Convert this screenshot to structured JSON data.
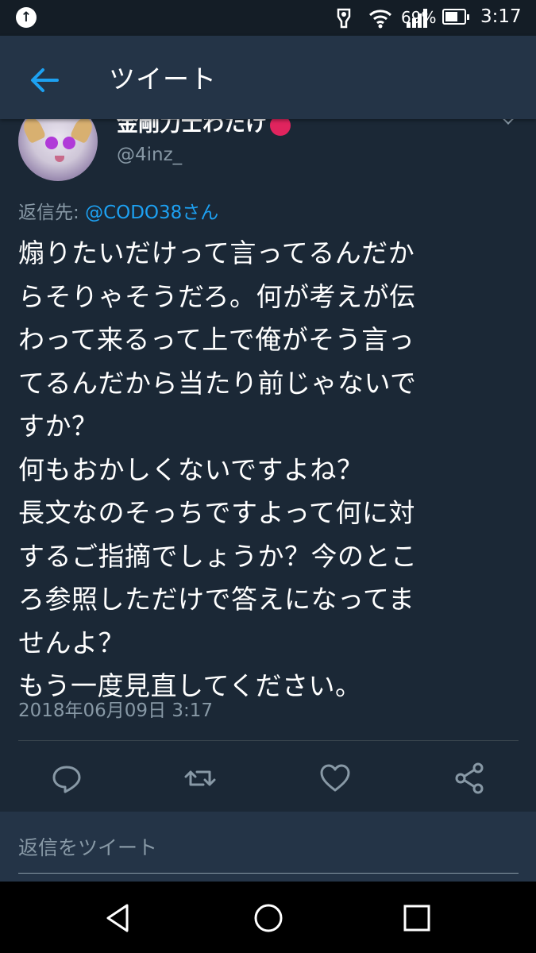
{
  "status_bar": {
    "battery_percent": "69%",
    "time": "3:17",
    "battery_level": 0.69
  },
  "app_bar": {
    "title": "ツイート"
  },
  "tweet": {
    "display_name": "金剛力士わたけ",
    "handle": "@4inz_",
    "replying_to_prefix": "返信先: ",
    "replying_to_mention": "@CODO38さん",
    "text_lines": [
      "煽りたいだけって言ってるんだか",
      "らそりゃそうだろ。何が考えが伝",
      "わって来るって上で俺がそう言っ",
      "てるんだから当たり前じゃないで",
      "すか？",
      "何もおかしくないですよね？",
      "長文なのそっちですよって何に対",
      "するご指摘でしょうか？今のとこ",
      "ろ参照しただけで答えになってま",
      "せんよ？",
      "もう一度見直してください。"
    ],
    "timestamp": "2018年06月09日 3:17"
  },
  "actions": {
    "reply_icon": "reply-icon",
    "retweet_icon": "retweet-icon",
    "like_icon": "heart-icon",
    "share_icon": "share-icon"
  },
  "reply_box": {
    "placeholder": "返信をツイート"
  },
  "colors": {
    "background": "#1b2836",
    "app_bar": "#243447",
    "accent": "#1da1f2",
    "secondary_text": "#8899a6"
  }
}
